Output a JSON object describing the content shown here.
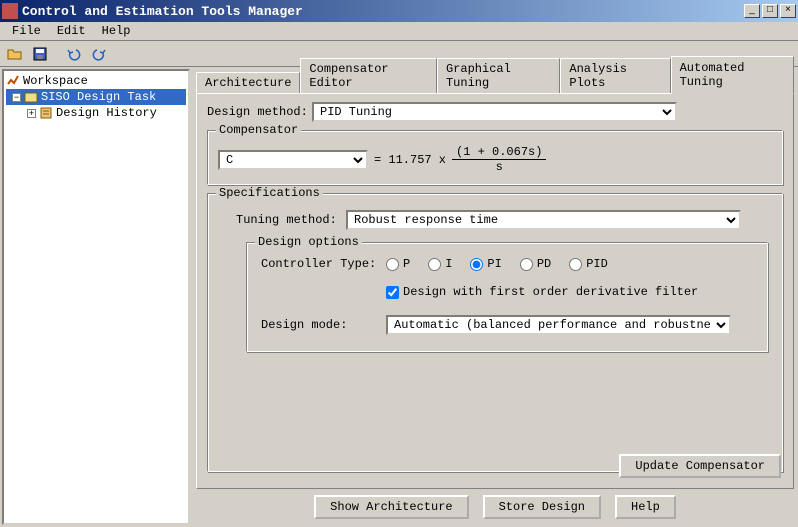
{
  "title": "Control and Estimation Tools Manager",
  "menu": {
    "file": "File",
    "edit": "Edit",
    "help": "Help"
  },
  "tree": {
    "workspace": "Workspace",
    "siso": "SISO Design Task",
    "history": "Design History"
  },
  "tabs": {
    "arch": "Architecture",
    "comp": "Compensator Editor",
    "graph": "Graphical Tuning",
    "analysis": "Analysis Plots",
    "auto": "Automated Tuning"
  },
  "design_method_label": "Design method:",
  "design_method_value": "PID Tuning",
  "compensator_legend": "Compensator",
  "compensator_name": "C",
  "compensator_eq_prefix": "= 11.757 x",
  "compensator_numer": "(1 + 0.067s)",
  "compensator_denom": "s",
  "specs_legend": "Specifications",
  "tuning_method_label": "Tuning method:",
  "tuning_method_value": "Robust response time",
  "design_options_legend": "Design options",
  "controller_type_label": "Controller Type:",
  "controller_types": {
    "p": "P",
    "i": "I",
    "pi": "PI",
    "pd": "PD",
    "pid": "PID"
  },
  "controller_selected": "pi",
  "deriv_filter_label": "Design with first order derivative filter",
  "deriv_filter_checked": true,
  "design_mode_label": "Design mode:",
  "design_mode_value": "Automatic (balanced performance and robustness)",
  "update_btn": "Update Compensator",
  "bottom": {
    "show_arch": "Show Architecture",
    "store": "Store Design",
    "help": "Help"
  }
}
